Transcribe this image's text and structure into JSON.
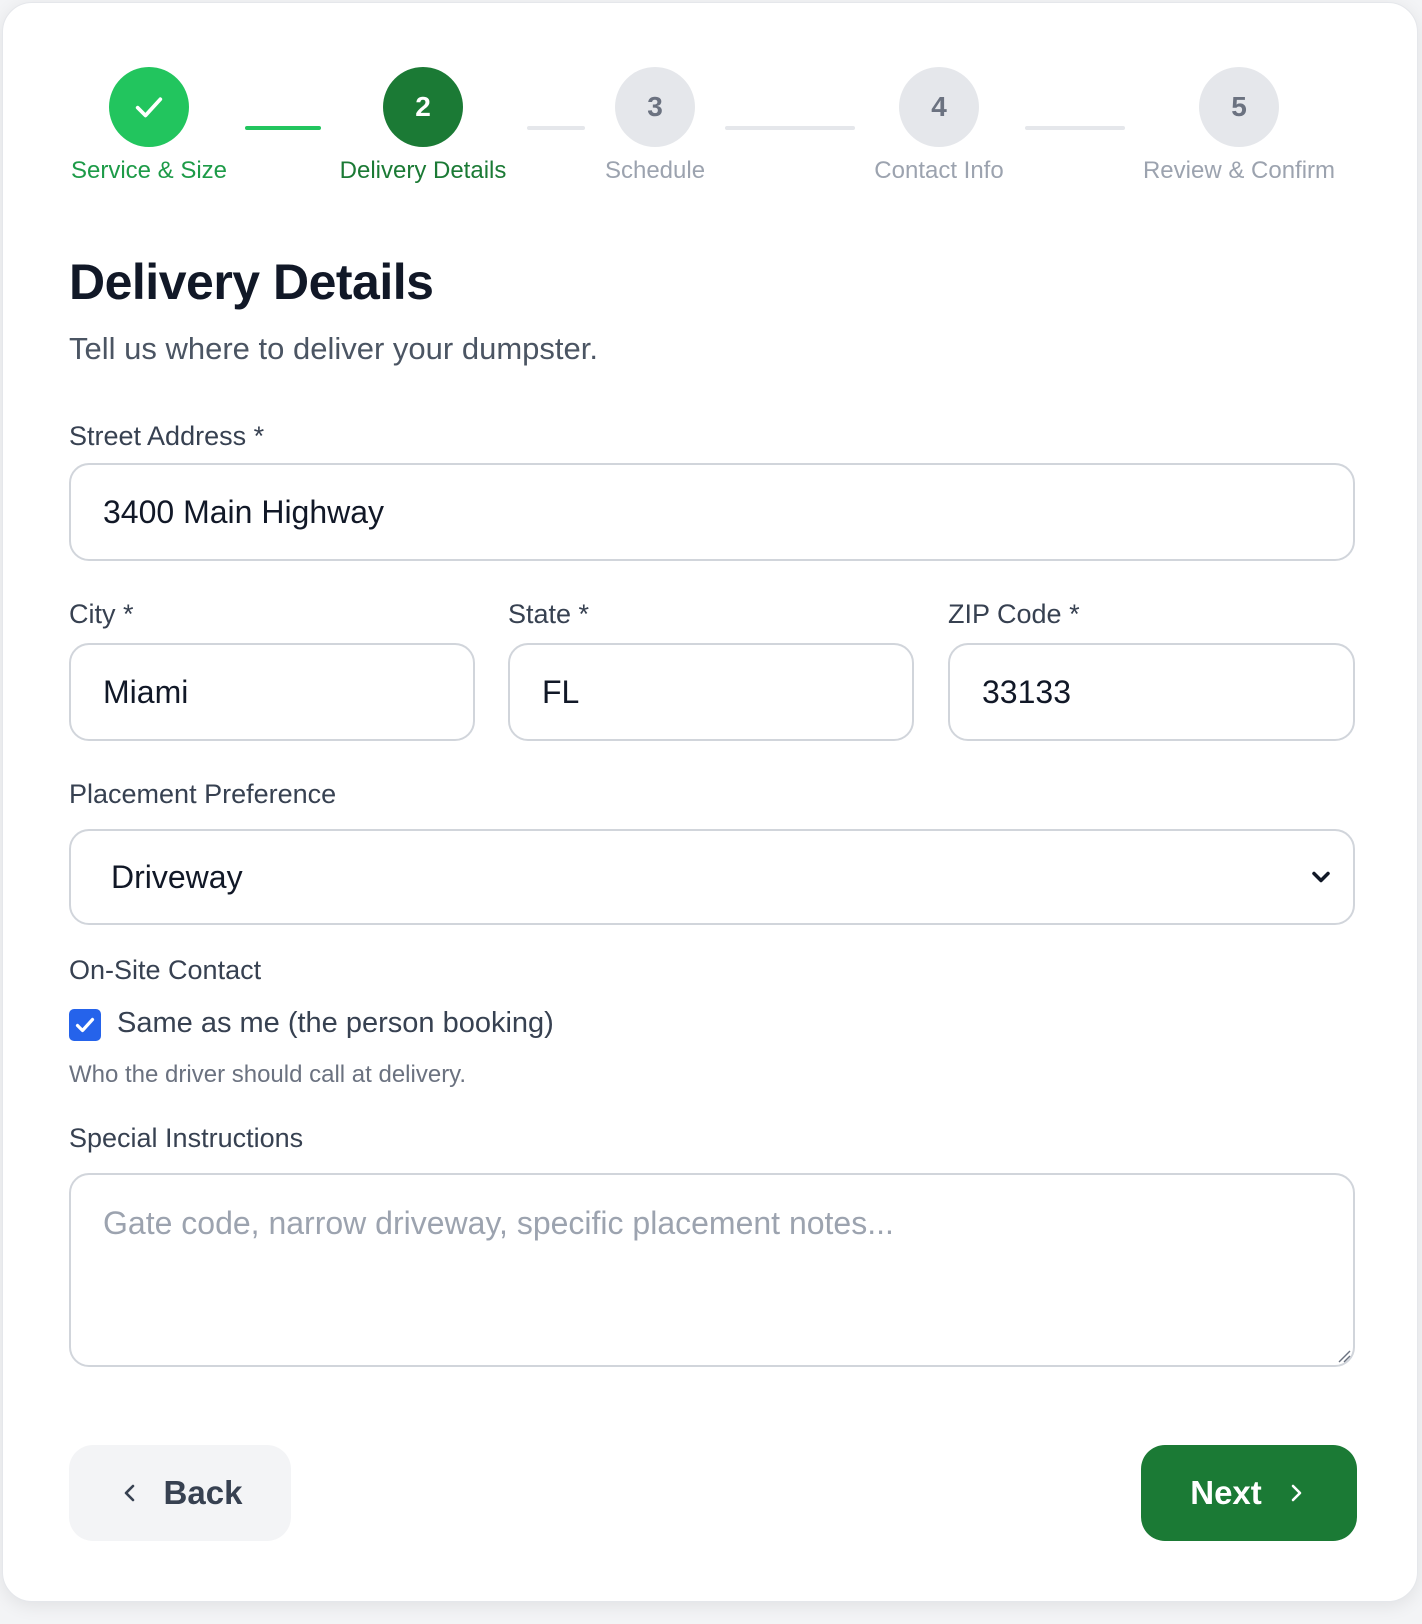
{
  "stepper": {
    "steps": [
      {
        "number": "1",
        "label": "Service & Size",
        "status": "done"
      },
      {
        "number": "2",
        "label": "Delivery Details",
        "status": "active"
      },
      {
        "number": "3",
        "label": "Schedule",
        "status": "pending"
      },
      {
        "number": "4",
        "label": "Contact Info",
        "status": "pending"
      },
      {
        "number": "5",
        "label": "Review & Confirm",
        "status": "pending"
      }
    ]
  },
  "header": {
    "title": "Delivery Details",
    "subtitle": "Tell us where to deliver your dumpster."
  },
  "form": {
    "street": {
      "label": "Street Address *",
      "value": "3400 Main Highway"
    },
    "city": {
      "label": "City *",
      "value": "Miami"
    },
    "state": {
      "label": "State *",
      "value": "FL"
    },
    "zip": {
      "label": "ZIP Code *",
      "value": "33133"
    },
    "placement": {
      "label": "Placement Preference",
      "selected": "Driveway"
    },
    "onsite": {
      "label": "On-Site Contact",
      "checkbox_label": "Same as me (the person booking)",
      "checked": true,
      "help": "Who the driver should call at delivery."
    },
    "instructions": {
      "label": "Special Instructions",
      "value": "",
      "placeholder": "Gate code, narrow driveway, specific placement notes..."
    }
  },
  "footer": {
    "back_label": "Back",
    "next_label": "Next"
  },
  "colors": {
    "accent": "#1b7a35",
    "done": "#22c55e",
    "checkbox": "#2563eb"
  },
  "icons": {
    "done_step": "check-icon",
    "select": "chevron-down-icon",
    "back": "chevron-left-icon",
    "next": "chevron-right-icon"
  }
}
